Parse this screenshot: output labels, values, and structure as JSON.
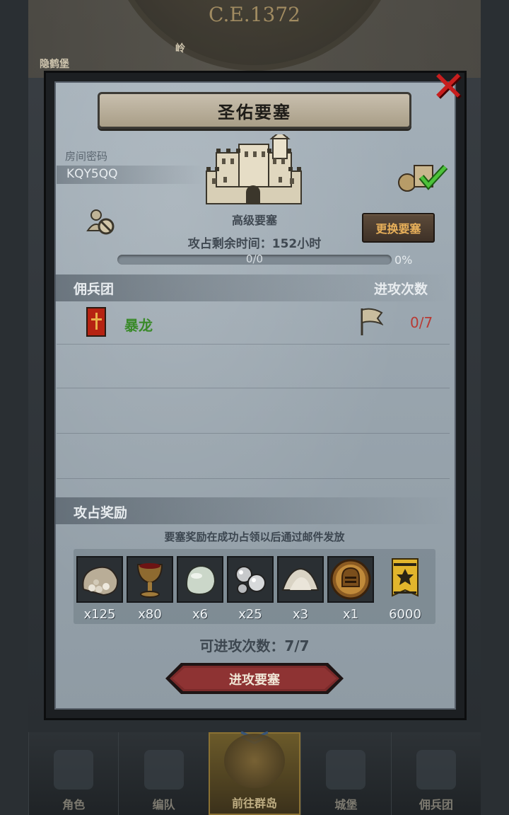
{
  "background": {
    "era": "C.E.1372",
    "map_labels": [
      "隐鹤堡",
      "岭"
    ]
  },
  "modal": {
    "title": "圣佑要塞",
    "room_code_label": "房间密码",
    "room_code": "KQY5QQ",
    "fortress_type": "高级要塞",
    "timer_label": "攻占剩余时间：",
    "timer_value": "152小时",
    "change_button": "更换要塞",
    "progress": {
      "text": "0/0",
      "percent_label": "0%",
      "fraction": 0
    },
    "mercenary_header": "佣兵团",
    "attack_count_header": "进攻次数",
    "mercenaries": [
      {
        "name": "暴龙",
        "attacks": "0/7",
        "name_color": "#3a8a2a",
        "count_color": "#b83a34"
      }
    ],
    "reward_header": "攻占奖励",
    "reward_note": "要塞奖励在成功占领以后通过邮件发放",
    "rewards": [
      {
        "icon": "ore-sack-icon",
        "qty": "x125"
      },
      {
        "icon": "goblet-icon",
        "qty": "x80"
      },
      {
        "icon": "pale-stone-icon",
        "qty": "x6"
      },
      {
        "icon": "silver-pearls-icon",
        "qty": "x25"
      },
      {
        "icon": "salt-pile-icon",
        "qty": "x3"
      },
      {
        "icon": "knight-helmet-medal-icon",
        "qty": "x1"
      },
      {
        "icon": "gold-banner-badge-icon",
        "qty": "6000"
      }
    ],
    "attacks_left_label": "可进攻次数：",
    "attacks_left_value": "7/7",
    "attack_button": "进攻要塞"
  },
  "bottom_nav": [
    {
      "label": "角色",
      "active": false
    },
    {
      "label": "编队",
      "active": false
    },
    {
      "label": "前往群岛",
      "active": true
    },
    {
      "label": "城堡",
      "active": false
    },
    {
      "label": "佣兵团",
      "active": false
    }
  ]
}
